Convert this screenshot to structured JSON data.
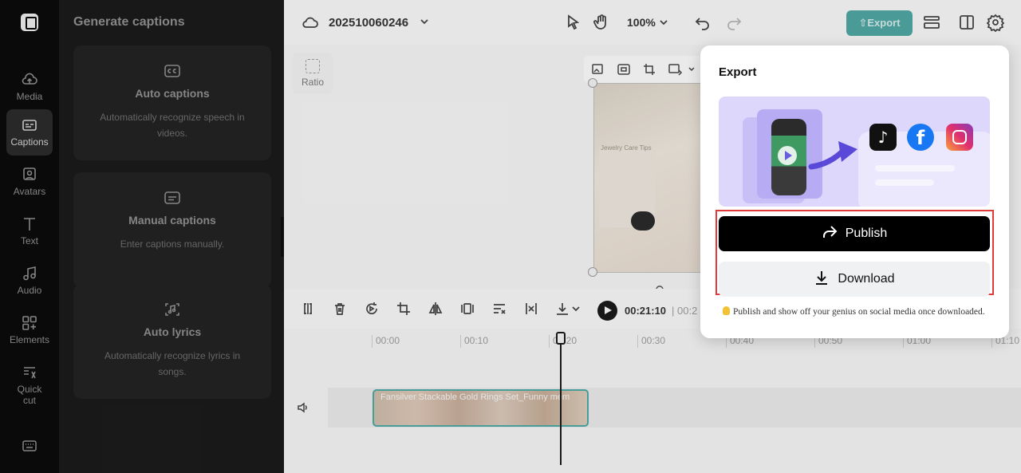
{
  "rail": {
    "items": [
      {
        "label": "Media",
        "icon": "cloud-upload-icon"
      },
      {
        "label": "Captions",
        "icon": "captions-icon"
      },
      {
        "label": "Avatars",
        "icon": "avatar-icon"
      },
      {
        "label": "Text",
        "icon": "text-icon"
      },
      {
        "label": "Audio",
        "icon": "music-note-icon"
      },
      {
        "label": "Elements",
        "icon": "elements-icon"
      },
      {
        "label": "Quick cut",
        "icon": "quick-cut-icon"
      }
    ],
    "active": "Captions"
  },
  "panel": {
    "title": "Generate captions",
    "cards": [
      {
        "title": "Auto captions",
        "desc": "Automatically recognize speech in videos.",
        "icon": "cc-icon"
      },
      {
        "title": "Manual captions",
        "desc": "Enter captions manually.",
        "icon": "subtitle-icon"
      },
      {
        "title": "Auto lyrics",
        "desc": "Automatically recognize lyrics in songs.",
        "icon": "lyrics-icon"
      }
    ]
  },
  "topbar": {
    "project_name": "202510060246",
    "zoom": "100%",
    "export_label": "Export"
  },
  "canvas": {
    "ratio_label": "Ratio",
    "preview_tag": "Jewelry Care Tips"
  },
  "timeline": {
    "current_time": "00:21:10",
    "total_time": "00:2",
    "ticks": [
      "00:00",
      "00:10",
      "00:20",
      "00:30",
      "00:40",
      "00:50",
      "01:00",
      "01:10"
    ],
    "clip_title": "Fansilver Stackable Gold Rings Set_Funny mem"
  },
  "export_popover": {
    "title": "Export",
    "publish_label": "Publish",
    "download_label": "Download",
    "hint": "Publish and show off your genius on social media once downloaded.",
    "highlight_color": "#e03a3a"
  },
  "colors": {
    "accent": "#4fa3a0",
    "rail_bg": "#0b0b0b",
    "panel_bg": "#1a1a1a"
  }
}
